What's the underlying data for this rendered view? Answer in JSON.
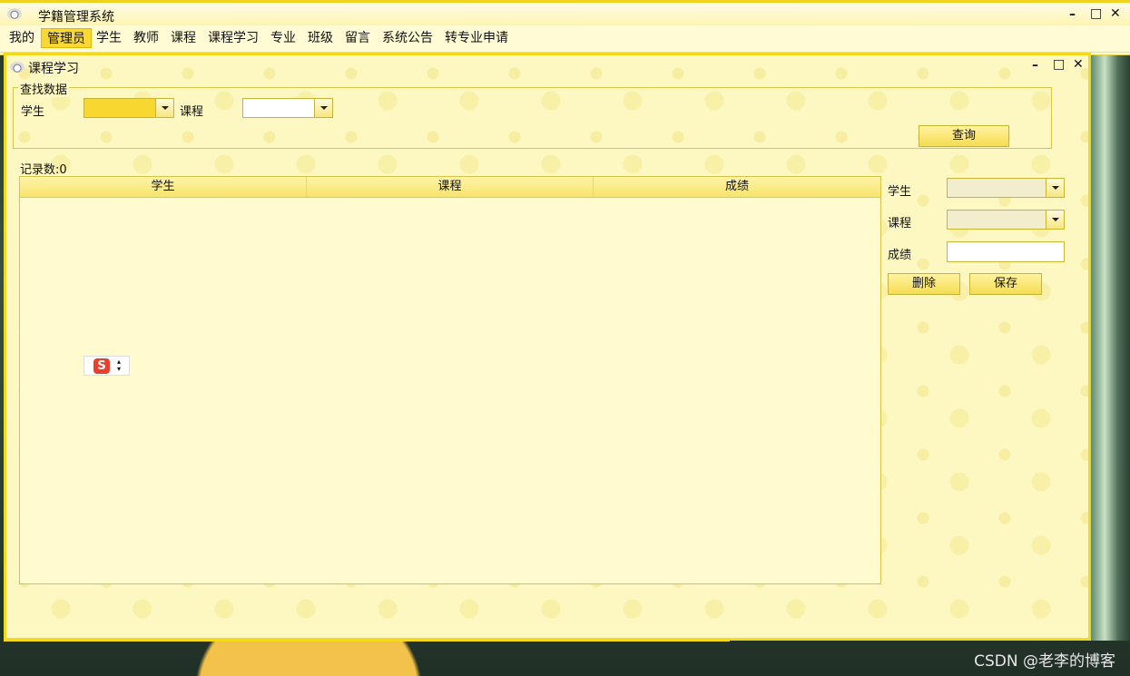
{
  "app": {
    "title": "学籍管理系统",
    "window_controls": {
      "minimize": "–",
      "maximize": "□",
      "close": "✕"
    }
  },
  "menu": {
    "items": [
      {
        "label": "我的"
      },
      {
        "label": "管理员",
        "active": true
      },
      {
        "label": "学生"
      },
      {
        "label": "教师"
      },
      {
        "label": "课程"
      },
      {
        "label": "课程学习"
      },
      {
        "label": "专业"
      },
      {
        "label": "班级"
      },
      {
        "label": "留言"
      },
      {
        "label": "系统公告"
      },
      {
        "label": "转专业申请"
      }
    ]
  },
  "inner_window": {
    "title": "课程学习",
    "search": {
      "legend": "查找数据",
      "student_label": "学生",
      "student_value": "",
      "course_label": "课程",
      "course_value": "",
      "query_button": "查询"
    },
    "record_count": "记录数:0",
    "table": {
      "columns": [
        "学生",
        "课程",
        "成绩"
      ],
      "rows": []
    },
    "edit": {
      "student_label": "学生",
      "student_value": "",
      "course_label": "课程",
      "course_value": "",
      "score_label": "成绩",
      "score_value": "",
      "delete_button": "删除",
      "save_button": "保存"
    }
  },
  "ime": {
    "logo": "S"
  },
  "watermark": "CSDN @老李的博客",
  "colors": {
    "accent": "#f3d81d",
    "panel": "#fdf7c2",
    "header": "#f8e46e"
  }
}
